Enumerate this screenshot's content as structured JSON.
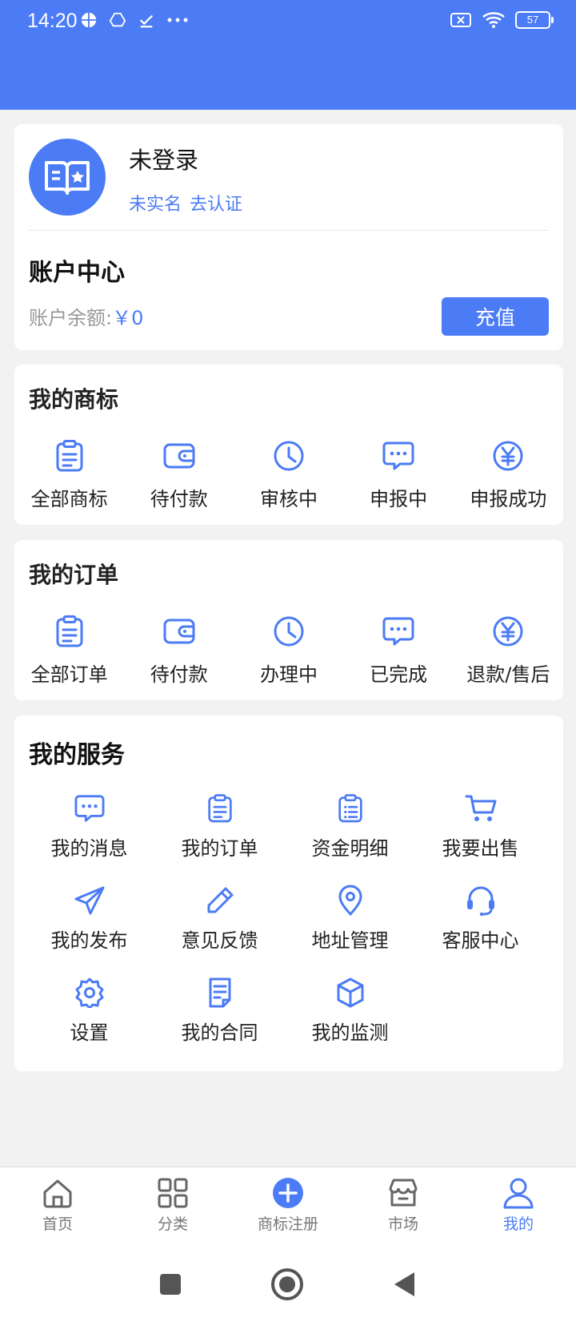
{
  "status_bar": {
    "time": "14:20",
    "battery": "57"
  },
  "profile": {
    "name": "未登录",
    "verify_status": "未实名",
    "verify_link": "去认证"
  },
  "account": {
    "title": "账户中心",
    "balance_label": "账户余额:",
    "balance_value": "￥0",
    "recharge_label": "充值"
  },
  "trademarks": {
    "title": "我的商标",
    "items": [
      {
        "label": "全部商标",
        "icon": "clipboard-icon"
      },
      {
        "label": "待付款",
        "icon": "wallet-icon"
      },
      {
        "label": "审核中",
        "icon": "clock-icon"
      },
      {
        "label": "申报中",
        "icon": "chat-icon"
      },
      {
        "label": "申报成功",
        "icon": "yen-icon"
      }
    ]
  },
  "orders": {
    "title": "我的订单",
    "items": [
      {
        "label": "全部订单",
        "icon": "clipboard-icon"
      },
      {
        "label": "待付款",
        "icon": "wallet-icon"
      },
      {
        "label": "办理中",
        "icon": "clock-icon"
      },
      {
        "label": "已完成",
        "icon": "chat-icon"
      },
      {
        "label": "退款/售后",
        "icon": "yen-icon"
      }
    ]
  },
  "services": {
    "title": "我的服务",
    "items": [
      {
        "label": "我的消息",
        "icon": "message-icon"
      },
      {
        "label": "我的订单",
        "icon": "clipboard-icon"
      },
      {
        "label": "资金明细",
        "icon": "list-icon"
      },
      {
        "label": "我要出售",
        "icon": "cart-icon"
      },
      {
        "label": "我的发布",
        "icon": "send-icon"
      },
      {
        "label": "意见反馈",
        "icon": "pencil-icon"
      },
      {
        "label": "地址管理",
        "icon": "location-icon"
      },
      {
        "label": "客服中心",
        "icon": "headset-icon"
      },
      {
        "label": "设置",
        "icon": "gear-icon"
      },
      {
        "label": "我的合同",
        "icon": "document-icon"
      },
      {
        "label": "我的监测",
        "icon": "box-icon"
      }
    ]
  },
  "tabbar": {
    "items": [
      {
        "label": "首页",
        "icon": "home-icon"
      },
      {
        "label": "分类",
        "icon": "grid-icon"
      },
      {
        "label": "商标注册",
        "icon": "plus-circle-icon"
      },
      {
        "label": "市场",
        "icon": "store-icon"
      },
      {
        "label": "我的",
        "icon": "user-icon"
      }
    ]
  },
  "colors": {
    "primary": "#4b7bf5",
    "background": "#f2f2f2"
  }
}
